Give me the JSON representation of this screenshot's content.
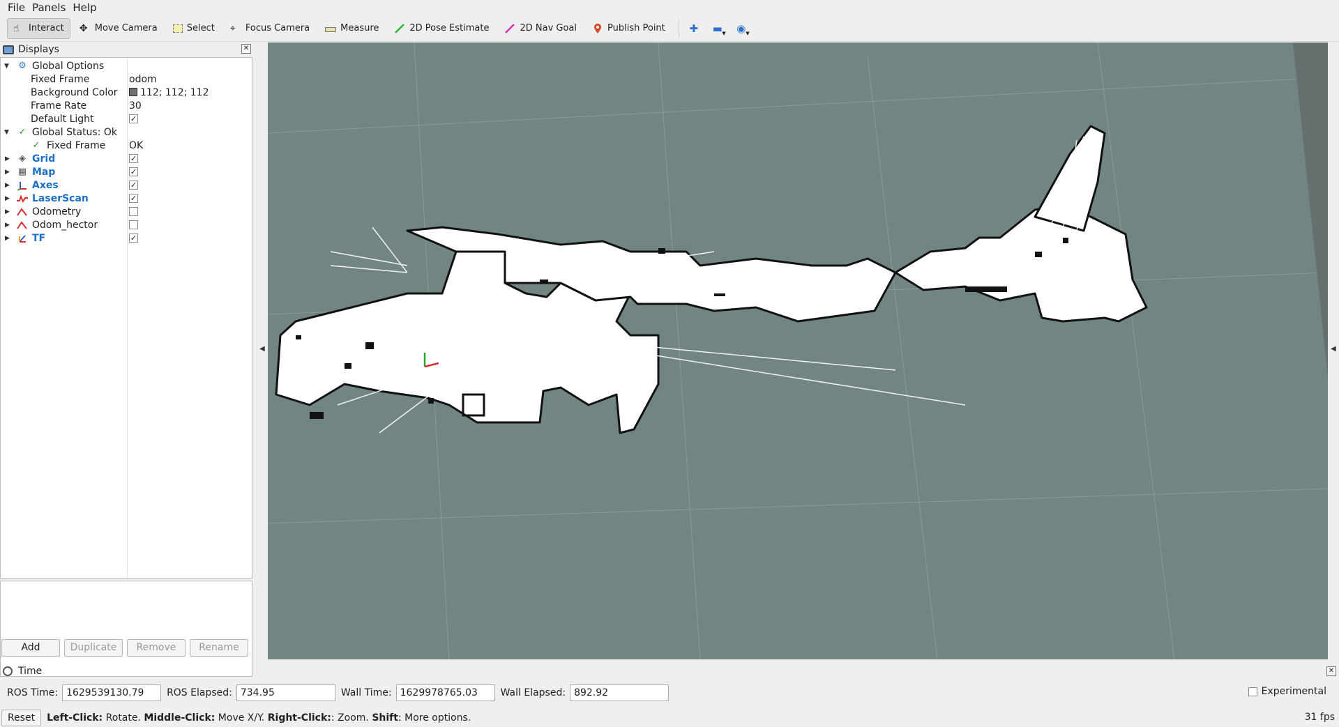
{
  "menu": [
    "File",
    "Panels",
    "Help"
  ],
  "toolbar": {
    "tools": [
      {
        "label": "Interact",
        "icon": "hand-icon"
      },
      {
        "label": "Move Camera",
        "icon": "move-camera-icon"
      },
      {
        "label": "Select",
        "icon": "select-icon"
      },
      {
        "label": "Focus Camera",
        "icon": "focus-camera-icon"
      },
      {
        "label": "Measure",
        "icon": "ruler-icon"
      },
      {
        "label": "2D Pose Estimate",
        "icon": "green-arrow-icon"
      },
      {
        "label": "2D Nav Goal",
        "icon": "magenta-arrow-icon"
      },
      {
        "label": "Publish Point",
        "icon": "map-pin-icon"
      }
    ],
    "active_tool": "Interact"
  },
  "displays": {
    "title": "Displays",
    "rows": [
      {
        "name": "Global Options",
        "value": ""
      },
      {
        "name": "Fixed Frame",
        "value": "odom"
      },
      {
        "name": "Background Color",
        "value": "112; 112; 112"
      },
      {
        "name": "Frame Rate",
        "value": "30"
      },
      {
        "name": "Default Light",
        "value": ""
      },
      {
        "name": "Global Status: Ok",
        "value": ""
      },
      {
        "name": "Fixed Frame",
        "value": "OK"
      },
      {
        "name": "Grid",
        "value": ""
      },
      {
        "name": "Map",
        "value": ""
      },
      {
        "name": "Axes",
        "value": ""
      },
      {
        "name": "LaserScan",
        "value": ""
      },
      {
        "name": "Odometry",
        "value": ""
      },
      {
        "name": "Odom_hector",
        "value": ""
      },
      {
        "name": "TF",
        "value": ""
      }
    ],
    "buttons": [
      "Add",
      "Duplicate",
      "Remove",
      "Rename"
    ]
  },
  "time": {
    "title": "Time",
    "ros_time_label": "ROS Time:",
    "ros_time": "1629539130.79",
    "ros_elapsed_label": "ROS Elapsed:",
    "ros_elapsed": "734.95",
    "wall_time_label": "Wall Time:",
    "wall_time": "1629978765.03",
    "wall_elapsed_label": "Wall Elapsed:",
    "wall_elapsed": "892.92",
    "experimental": "Experimental"
  },
  "status": {
    "reset": "Reset",
    "hint_b1": "Left-Click:",
    "hint_t1": " Rotate. ",
    "hint_b2": "Middle-Click:",
    "hint_t2": " Move X/Y. ",
    "hint_b3": "Right-Click:",
    "hint_t3": ": Zoom. ",
    "hint_b4": "Shift",
    "hint_t4": ": More options.",
    "fps": "31 fps"
  },
  "colors": {
    "viewport_bg": "#708584",
    "grid": "#8a9a99",
    "link_blue": "#1d6fc7"
  }
}
